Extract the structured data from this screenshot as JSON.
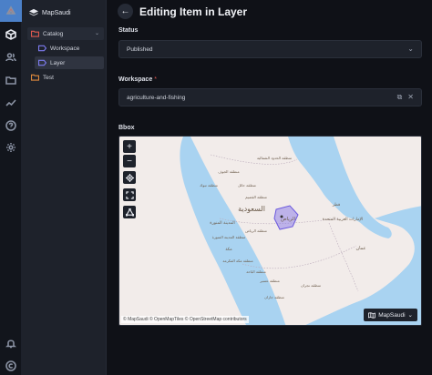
{
  "window": {
    "brand": "MapSaudi"
  },
  "rail": {
    "icons": [
      "catalog-cube-icon",
      "users-icon",
      "folder-icon",
      "chart-line-icon",
      "help-icon",
      "settings-icon",
      "bell-icon",
      "copyright-icon"
    ]
  },
  "tree": {
    "items": [
      {
        "label": "Catalog",
        "icon": "folder-icon",
        "color": "#e05a4f",
        "expanded": true
      },
      {
        "label": "Workspace",
        "icon": "tag-icon",
        "color": "#7d7cf0"
      },
      {
        "label": "Layer",
        "icon": "tag-icon",
        "color": "#7d7cf0",
        "selected": true
      },
      {
        "label": "Test",
        "icon": "folder-icon",
        "color": "#e08a3c"
      }
    ]
  },
  "header": {
    "title": "Editing Item in Layer"
  },
  "form": {
    "status": {
      "label": "Status",
      "value": "Published"
    },
    "workspace": {
      "label": "Workspace",
      "required_mark": "*",
      "value": "agriculture-and-fishing"
    },
    "bbox": {
      "label": "Bbox"
    }
  },
  "map": {
    "controls": [
      "zoom-in",
      "zoom-out",
      "locate",
      "fullscreen",
      "draw"
    ],
    "attribution": "© MapSaudi © OpenMapTiles © OpenStreetMap contributors",
    "switcher_label": "MapSaudi",
    "colors": {
      "land": "#f2ecea",
      "water": "#a9d3f1",
      "bbox": "#7d6ce8"
    },
    "place_labels": [
      "الرياض",
      "منطقة الرياض",
      "منطقة الجوف",
      "منطقة تبوك",
      "منطقة الحدود الشمالية",
      "منطقة حائل",
      "منطقة القصيم",
      "المدينة المنورة",
      "منطقة المدينة المنورة",
      "مكة",
      "منطقة مكة المكرمة",
      "منطقة الباحة",
      "منطقة عسير",
      "منطقة جازان",
      "منطقة نجران",
      "الإمارات العربية المتحدة",
      "قطر",
      "عمان"
    ],
    "country_label": "السعودية"
  },
  "colors": {
    "accent": "#4b80c8",
    "danger": "#e0584f"
  }
}
